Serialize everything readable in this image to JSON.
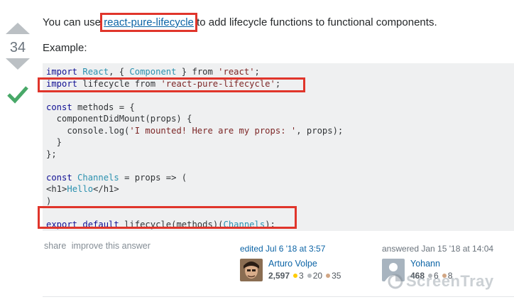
{
  "vote": {
    "count": "34",
    "up_icon": "arrow-up-icon",
    "down_icon": "arrow-down-icon",
    "accepted_icon": "check-icon",
    "accepted_color": "#48a868"
  },
  "body": {
    "intro_before": "You can use ",
    "link_text": "react-pure-lifecycle",
    "intro_after": " to add lifecycle functions to functional components.",
    "example_label": "Example:"
  },
  "code": {
    "l1a": "import",
    "l1b": " ",
    "l1c": "React",
    "l1d": ", { ",
    "l1e": "Component",
    "l1f": " } from ",
    "l1g": "'react'",
    "l1h": ";",
    "l2a": "import",
    "l2b": " lifecycle from ",
    "l2c": "'react-pure-lifecycle'",
    "l2d": ";",
    "l4a": "const",
    "l4b": " methods = {",
    "l5": "  componentDidMount(props) {",
    "l6a": "    console.log(",
    "l6b": "'I mounted! Here are my props: '",
    "l6c": ", props);",
    "l7": "  }",
    "l8": "};",
    "l10a": "const",
    "l10b": " ",
    "l10c": "Channels",
    "l10d": " = props => (",
    "l11a": "<h1>",
    "l11b": "Hello",
    "l11c": "</h1>",
    "l12": ")",
    "l14a": "export",
    "l14b": " ",
    "l14c": "default",
    "l14d": " lifecycle(methods)(",
    "l14e": "Channels",
    "l14f": ");"
  },
  "actions": {
    "share": "share",
    "improve": "improve this answer"
  },
  "edited": {
    "label": "edited Jul 6 '18 at 3:57",
    "user": "Arturo Volpe",
    "rep": "2,597",
    "gold": "3",
    "silver": "20",
    "bronze": "35"
  },
  "answered": {
    "label": "answered Jan 15 '18 at 14:04",
    "user": "Yohann",
    "rep": "468",
    "silver": "6",
    "bronze": "8"
  },
  "badge_colors": {
    "gold": "#ffcc01",
    "silver": "#b4b8bc",
    "bronze": "#d1a684"
  },
  "watermark": {
    "text": "ScreenTray"
  }
}
